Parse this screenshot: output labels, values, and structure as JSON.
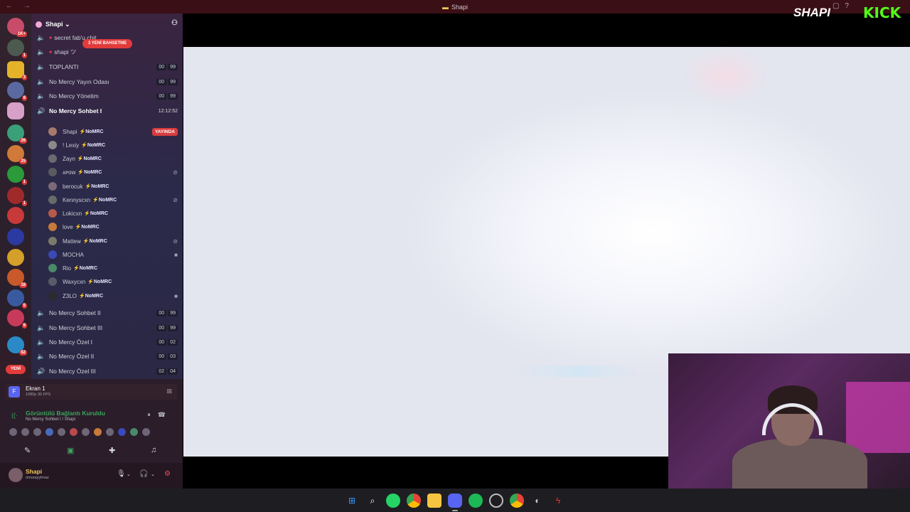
{
  "window": {
    "title": "Shapi",
    "nav": "← →"
  },
  "overlay": {
    "brand": "SHAPI",
    "platform": "KICK"
  },
  "server_badges": [
    "1K+",
    "1",
    "3",
    "8",
    "26",
    "25",
    "1",
    "1",
    "18",
    "5",
    "9",
    "62"
  ],
  "server_new_label": "YENİ",
  "guild": {
    "name": "Shapi ⌄"
  },
  "mention_pill": "3 YENİ BAHSETME",
  "text_channels": [
    {
      "name": "secret fab'u chit"
    },
    {
      "name": "shapi ツ"
    }
  ],
  "voice_channels_top": [
    {
      "name": "TOPLANTI",
      "count": [
        "00",
        "99"
      ]
    },
    {
      "name": "No Mercy Yayın Odası",
      "count": [
        "00",
        "99"
      ]
    },
    {
      "name": "No Mercy Yönetim",
      "count": [
        "00",
        "99"
      ]
    }
  ],
  "active_channel": {
    "name": "No Mercy Sohbet I",
    "time": "12:12:52"
  },
  "live_label": "YAYINDA",
  "tag": "NoMRC",
  "members": [
    {
      "name": "Shapi",
      "tag": true,
      "indicator": "live"
    },
    {
      "name": "! Lexiy",
      "tag": true,
      "indicator": ""
    },
    {
      "name": "Zayn",
      "tag": true,
      "indicator": ""
    },
    {
      "name": "ᴀᴘᴏᴡ",
      "tag": true,
      "indicator": "deaf"
    },
    {
      "name": "berocuk",
      "tag": true,
      "indicator": ""
    },
    {
      "name": "Kennyscxn",
      "tag": true,
      "indicator": "deaf"
    },
    {
      "name": "Lokicxn",
      "tag": true,
      "indicator": ""
    },
    {
      "name": "love",
      "tag": true,
      "indicator": ""
    },
    {
      "name": "Mattew",
      "tag": true,
      "indicator": "deaf"
    },
    {
      "name": "MOCHA",
      "tag": false,
      "indicator": "video"
    },
    {
      "name": "Rio",
      "tag": true,
      "indicator": ""
    },
    {
      "name": "Waxycxn",
      "tag": true,
      "indicator": ""
    },
    {
      "name": "Z3LO",
      "tag": true,
      "indicator": "video"
    }
  ],
  "voice_channels_bottom": [
    {
      "name": "No Mercy Sohbet II",
      "count": [
        "00",
        "99"
      ]
    },
    {
      "name": "No Mercy Sohbet III",
      "count": [
        "00",
        "99"
      ]
    },
    {
      "name": "No Mercy Özel I",
      "count": [
        "00",
        "02"
      ]
    },
    {
      "name": "No Mercy Özel II",
      "count": [
        "00",
        "03"
      ]
    },
    {
      "name": "No Mercy Özel III",
      "count": [
        "02",
        "04"
      ]
    }
  ],
  "stream": {
    "title": "Ekran 1",
    "quality": "1080p 30 FPS"
  },
  "connection": {
    "status": "Görüntülü Bağlantı Kuruldu",
    "location": "No Mercy Sohbet I / Shapi"
  },
  "user": {
    "name": "Shapi",
    "status": "omurayylmaz"
  }
}
